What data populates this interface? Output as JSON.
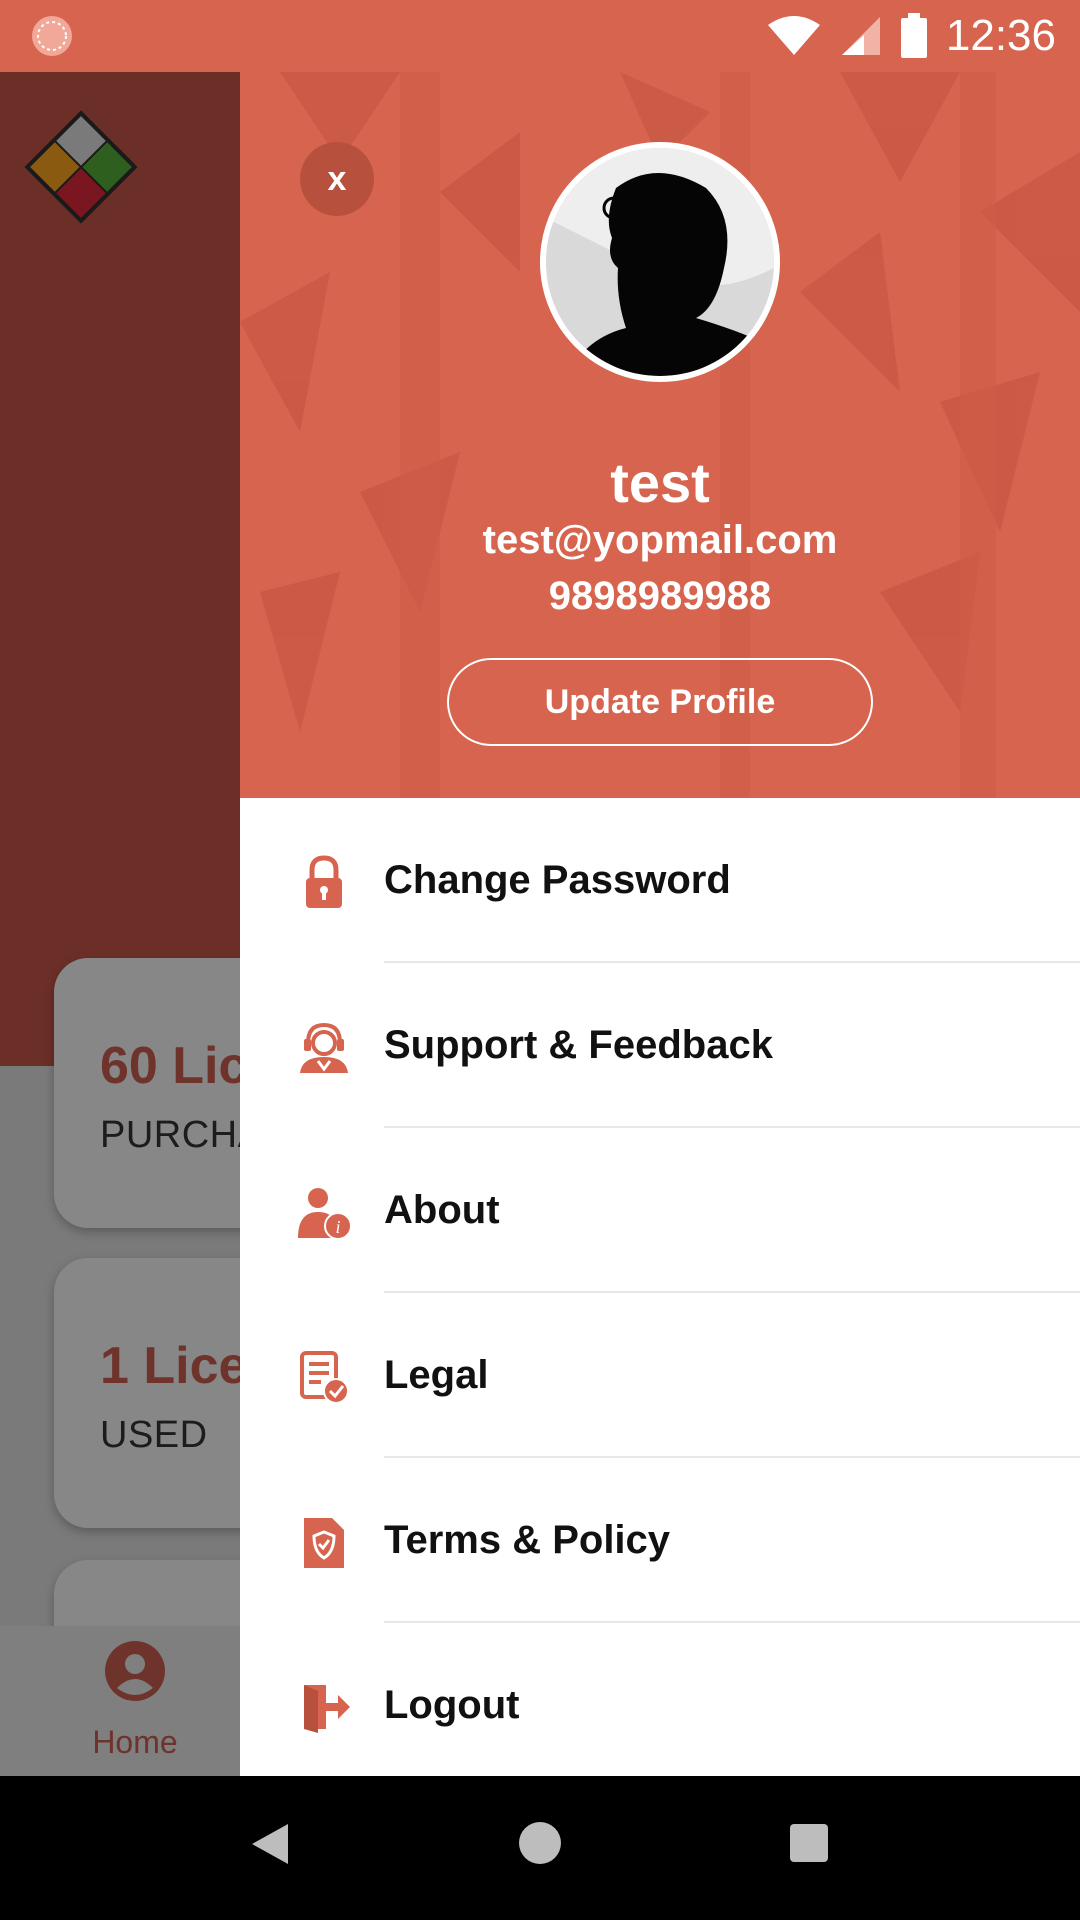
{
  "status_bar": {
    "time": "12:36"
  },
  "background_app": {
    "cards": [
      {
        "value": "60 Lic",
        "caption": "PURCHA"
      },
      {
        "value": "1 Lice",
        "caption": "USED"
      }
    ],
    "bottom_nav": {
      "home_label": "Home"
    }
  },
  "drawer": {
    "close_label": "x",
    "profile": {
      "name": "test",
      "email": "test@yopmail.com",
      "phone": "9898989988",
      "update_button": "Update Profile"
    },
    "menu_items": [
      {
        "label": "Change Password",
        "icon": "lock-icon"
      },
      {
        "label": "Support & Feedback",
        "icon": "support-agent-icon"
      },
      {
        "label": "About",
        "icon": "user-info-icon"
      },
      {
        "label": "Legal",
        "icon": "document-check-icon"
      },
      {
        "label": "Terms & Policy",
        "icon": "shield-document-icon"
      },
      {
        "label": "Logout",
        "icon": "logout-icon"
      }
    ]
  },
  "colors": {
    "accent": "#d6644e",
    "dim_header": "#6b2f28",
    "menu_text": "#111111"
  }
}
